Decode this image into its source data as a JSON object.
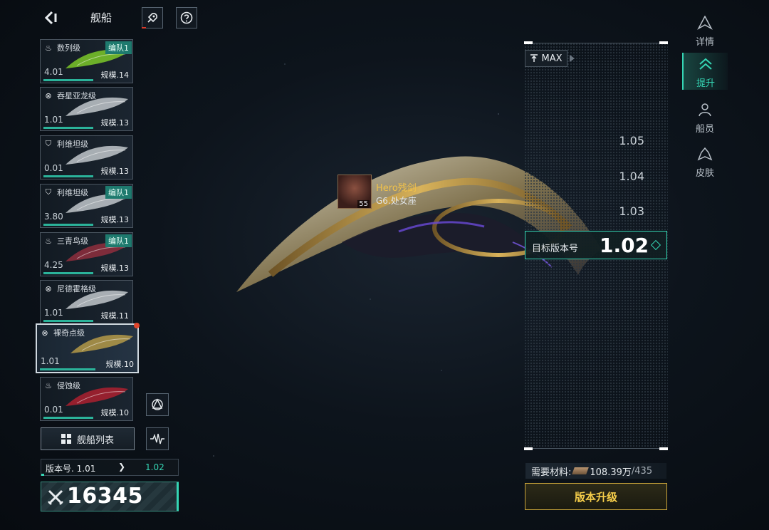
{
  "header": {
    "title": "舰船"
  },
  "ships": [
    {
      "name": "数列级",
      "version": "4.01",
      "scale": "规模.14",
      "badge": "编队1",
      "type": "flame",
      "color": "#8adf2a"
    },
    {
      "name": "吞星亚龙级",
      "version": "1.01",
      "scale": "规模.13",
      "badge": "",
      "type": "target",
      "color": "#d8dde2"
    },
    {
      "name": "利维坦级",
      "version": "0.01",
      "scale": "规模.13",
      "badge": "",
      "type": "shield",
      "color": "#d8dde2"
    },
    {
      "name": "利维坦级",
      "version": "3.80",
      "scale": "规模.13",
      "badge": "编队1",
      "type": "shield",
      "color": "#d8dde2"
    },
    {
      "name": "三青鸟级",
      "version": "4.25",
      "scale": "规模.13",
      "badge": "编队1",
      "type": "flame",
      "color": "#a03040"
    },
    {
      "name": "尼德霍格级",
      "version": "1.01",
      "scale": "规模.11",
      "badge": "",
      "type": "target",
      "color": "#d8dde2"
    },
    {
      "name": "裸奇点级",
      "version": "1.01",
      "scale": "规模.10",
      "badge": "",
      "type": "target",
      "color": "#c8a84a"
    },
    {
      "name": "侵蚀级",
      "version": "0.01",
      "scale": "规模.10",
      "badge": "",
      "type": "flame",
      "color": "#c02030"
    }
  ],
  "bottom": {
    "list_button": "舰船列表",
    "version_current": "版本号. 1.01",
    "version_next": "1.02",
    "power": "16345"
  },
  "pilot": {
    "name": "Hero残剑",
    "sign": "G6.处女座",
    "level": "55"
  },
  "upgrade_panel": {
    "max_label": "MAX",
    "levels": [
      "1.05",
      "1.04",
      "1.03"
    ],
    "target_label": "目标版本号",
    "target_value": "1.02",
    "material_label": "需要材料:",
    "material_owned": "108.39万",
    "material_need": "/435",
    "upgrade_button": "版本升级"
  },
  "tabs": [
    {
      "label": "详情"
    },
    {
      "label": "提升"
    },
    {
      "label": "船员"
    },
    {
      "label": "皮肤"
    }
  ],
  "colors": {
    "accent": "#35d5b4",
    "gold": "#f5cd4a",
    "alert": "#e0452c"
  }
}
